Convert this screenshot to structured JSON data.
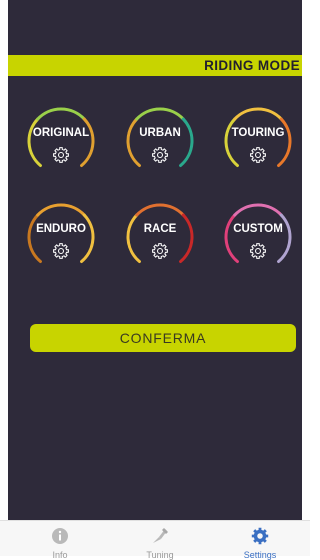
{
  "header": {
    "title": "RIDING MODE"
  },
  "modes": [
    {
      "label": "ORIGINAL",
      "colors": [
        "#d8d23a",
        "#9ad04a",
        "#e0a030"
      ]
    },
    {
      "label": "URBAN",
      "colors": [
        "#e0a030",
        "#9ad04a",
        "#2aa88c"
      ]
    },
    {
      "label": "TOURING",
      "colors": [
        "#d8d23a",
        "#f0c040",
        "#e8782a"
      ]
    },
    {
      "label": "ENDURO",
      "colors": [
        "#c87820",
        "#e8a030",
        "#f0c040"
      ]
    },
    {
      "label": "RACE",
      "colors": [
        "#f0c040",
        "#e07030",
        "#c82828"
      ]
    },
    {
      "label": "CUSTOM",
      "colors": [
        "#e0407a",
        "#e070b0",
        "#b0a4d0"
      ]
    }
  ],
  "confirm_label": "CONFERMA",
  "tabs": [
    {
      "label": "Info",
      "icon": "info-icon",
      "active": false
    },
    {
      "label": "Tuning",
      "icon": "tuning-icon",
      "active": false
    },
    {
      "label": "Settings",
      "icon": "gear-icon",
      "active": true
    }
  ],
  "colors": {
    "accent": "#c8d400",
    "background": "#2e2a3a",
    "active_tab": "#3a6fc2"
  }
}
